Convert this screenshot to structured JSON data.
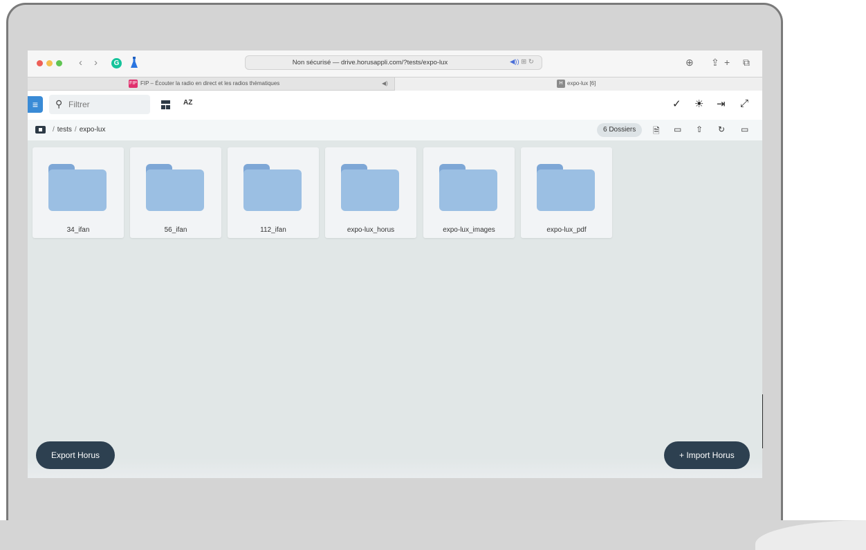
{
  "browser": {
    "url": "Non sécurisé — drive.horusappli.com/?tests/expo-lux",
    "tabs": [
      {
        "label": "FIP – Écouter la radio en direct et les radios thématiques",
        "favicon": "FIP",
        "active": false
      },
      {
        "label": "expo-lux [6]",
        "favicon": "H",
        "active": true
      }
    ]
  },
  "toolbar": {
    "filter_placeholder": "Filtrer",
    "sort_label": "AZ"
  },
  "breadcrumb": {
    "items": [
      "tests",
      "expo-lux"
    ],
    "count_badge": "6 Dossiers"
  },
  "folders": [
    {
      "name": "34_ifan"
    },
    {
      "name": "56_ifan"
    },
    {
      "name": "112_ifan"
    },
    {
      "name": "expo-lux_horus"
    },
    {
      "name": "expo-lux_images"
    },
    {
      "name": "expo-lux_pdf"
    }
  ],
  "actions": {
    "export_label": "Export Horus",
    "import_label": "+ Import Horus"
  },
  "colors": {
    "menu_button": "#3a8bd6",
    "folder_fill": "#9bbfe3",
    "folder_tab": "#7ea7d6",
    "pill_button": "#2d4050",
    "screen_bg": "#e1e7e7"
  }
}
